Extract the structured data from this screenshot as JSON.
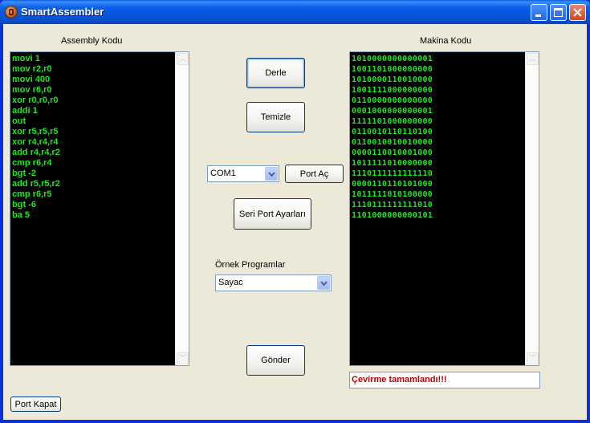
{
  "window": {
    "title": "SmartAssembler",
    "icon": "app-icon",
    "controls": [
      "minimize-icon",
      "maximize-icon",
      "close-icon"
    ]
  },
  "assembly": {
    "label": "Assembly Kodu",
    "lines": [
      "movi 1",
      "mov r2,r0",
      "movi 400",
      "mov r6,r0",
      "xor r0,r0,r0",
      "addi 1",
      "out",
      "xor r5,r5,r5",
      "xor r4,r4,r4",
      "add r4,r4,r2",
      "cmp r6,r4",
      "bgt -2",
      "add r5,r5,r2",
      "cmp r6,r5",
      "bgt -6",
      "ba 5"
    ]
  },
  "machine": {
    "label": "Makina Kodu",
    "lines": [
      "1010000000000001",
      "1001101000000000",
      "1010000110010000",
      "1001111000000000",
      "0110000000000000",
      "0001000000000001",
      "1111101000000000",
      "0110010110110100",
      "0110010010010000",
      "0000110010001000",
      "1011111010000000",
      "1110111111111110",
      "0000110110101000",
      "1011111010100000",
      "1110111111111010",
      "1101000000000101"
    ]
  },
  "buttons": {
    "compile": "Derle",
    "clear": "Temizle",
    "open_port": "Port Aç",
    "serial_settings": "Seri Port Ayarları",
    "send": "Gönder",
    "close_port": "Port Kapat"
  },
  "port_combo": {
    "selected": "COM1"
  },
  "examples": {
    "label": "Örnek Programlar",
    "selected": "Sayac"
  },
  "status": {
    "text": "Çevirme tamamlandı!!!",
    "color": "#c00000"
  },
  "colors": {
    "code_text": "#1ee51e",
    "code_bg": "#000000",
    "titlebar": "#0a5fe8"
  }
}
